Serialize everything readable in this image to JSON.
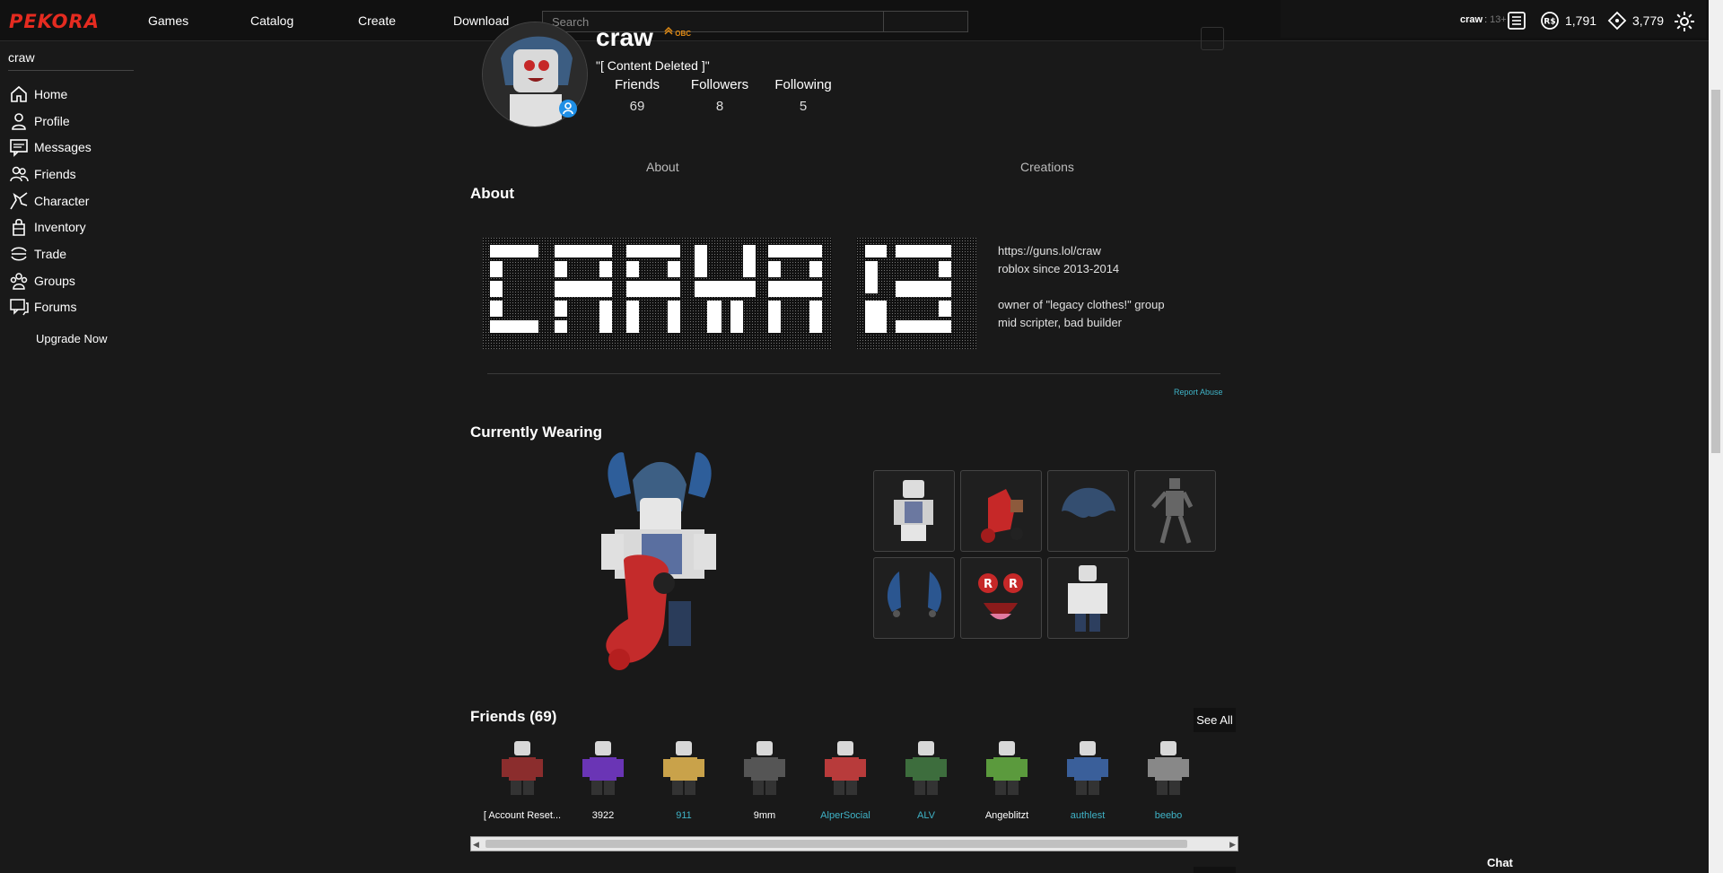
{
  "topbar": {
    "logo": "PEKORA",
    "nav": [
      "Games",
      "Catalog",
      "Create",
      "Download"
    ],
    "search_placeholder": "Search",
    "username": "craw",
    "age": "13+",
    "robux": "1,791",
    "tix": "3,779"
  },
  "sidebar": {
    "username": "craw",
    "items": [
      {
        "label": "Home",
        "icon": "home-icon"
      },
      {
        "label": "Profile",
        "icon": "person-icon"
      },
      {
        "label": "Messages",
        "icon": "messages-icon"
      },
      {
        "label": "Friends",
        "icon": "friends-icon"
      },
      {
        "label": "Character",
        "icon": "character-icon"
      },
      {
        "label": "Inventory",
        "icon": "inventory-icon"
      },
      {
        "label": "Trade",
        "icon": "trade-icon"
      },
      {
        "label": "Groups",
        "icon": "groups-icon"
      },
      {
        "label": "Forums",
        "icon": "forums-icon"
      }
    ],
    "upgrade": "Upgrade Now"
  },
  "profile": {
    "name": "craw",
    "badge": "OBC",
    "status": "\"[ Content Deleted ]\"",
    "stats": [
      {
        "label": "Friends",
        "value": "69"
      },
      {
        "label": "Followers",
        "value": "8"
      },
      {
        "label": "Following",
        "value": "5"
      }
    ],
    "tabs": [
      "About",
      "Creations"
    ]
  },
  "about": {
    "title": "About",
    "lines": [
      "https://guns.lol/craw",
      "roblox since 2013-2014",
      "",
      "owner of \"legacy clothes!\" group",
      "mid scripter, bad builder"
    ],
    "report": "Report Abuse"
  },
  "wearing": {
    "title": "Currently Wearing",
    "items": [
      "shirt-item",
      "scooter-item",
      "hair-item",
      "animation-item",
      "horns-item",
      "face-item",
      "pants-item"
    ]
  },
  "friends": {
    "title": "Friends (69)",
    "see_all": "See All",
    "list": [
      {
        "name": "[ Account Reset...",
        "color": "#ffffff"
      },
      {
        "name": "3922",
        "color": "#ffffff"
      },
      {
        "name": "911",
        "color": "#3fb3c7"
      },
      {
        "name": "9mm",
        "color": "#ffffff"
      },
      {
        "name": "AlperSocial",
        "color": "#3fb3c7"
      },
      {
        "name": "ALV",
        "color": "#3fb3c7"
      },
      {
        "name": "Angeblitzt",
        "color": "#ffffff"
      },
      {
        "name": "authlest",
        "color": "#3fb3c7"
      },
      {
        "name": "beebo",
        "color": "#3fb3c7"
      }
    ]
  },
  "chat": "Chat"
}
